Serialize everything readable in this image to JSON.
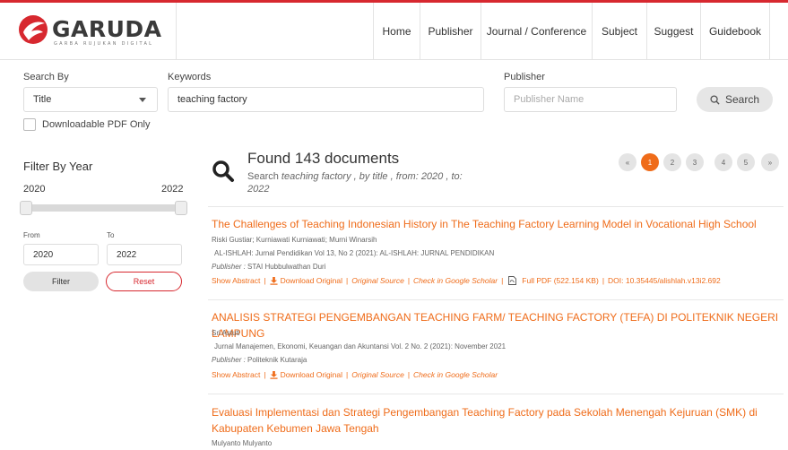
{
  "brand": {
    "name": "GARUDA",
    "tagline": "GARBA RUJUKAN DIGITAL",
    "accent": "#d7282f",
    "orange": "#ef6c1a"
  },
  "nav": [
    "Home",
    "Publisher",
    "Journal / Conference",
    "Subject",
    "Suggest",
    "Guidebook"
  ],
  "search": {
    "search_by_label": "Search By",
    "search_by_value": "Title",
    "keywords_label": "Keywords",
    "keywords_value": "teaching factory",
    "publisher_label": "Publisher",
    "publisher_placeholder": "Publisher Name",
    "search_button": "Search",
    "pdf_only_label": "Downloadable PDF Only"
  },
  "filter": {
    "title": "Filter By Year",
    "min_year": "2020",
    "max_year": "2022",
    "from_label": "From",
    "to_label": "To",
    "from_value": "2020",
    "to_value": "2022",
    "filter_button": "Filter",
    "reset_button": "Reset"
  },
  "results_header": {
    "found": "Found 143 documents",
    "desc_prefix": "Search ",
    "desc_query": "teaching factory",
    "desc_mid": " , by title , from: 2020 , to:",
    "desc_end": "2022"
  },
  "pagination": [
    "«",
    "1",
    "2",
    "3",
    "4",
    "5",
    "»"
  ],
  "results": [
    {
      "title": "The Challenges of Teaching Indonesian History in The Teaching Factory Learning Model in Vocational High School",
      "authors": "Riski Gustiar; Kurniawati Kurniawati; Murni Winarsih",
      "journal": "AL-ISHLAH: Jurnal Pendidikan Vol 13, No 2 (2021): AL-ISHLAH: JURNAL PENDIDIKAN",
      "publisher_label": "Publisher :",
      "publisher": "STAI Hubbulwathan Duri",
      "show_abstract": "Show Abstract",
      "download": "Download Original",
      "source": "Original Source",
      "scholar": "Check in Google Scholar",
      "pdf": "Full PDF (522.154 KB)",
      "doi": "DOI: 10.35445/alishlah.v13i2.692"
    },
    {
      "title": "ANALISIS STRATEGI PENGEMBANGAN TEACHING FARM/ TEACHING FACTORY (TEFA) DI POLITEKNIK NEGERI LAMPUNG",
      "authors": "Sri Astuti",
      "journal": "Jurnal Manajemen, Ekonomi, Keuangan dan Akuntansi Vol. 2 No. 2 (2021): November 2021",
      "publisher_label": "Publisher :",
      "publisher": "Politeknik Kutaraja",
      "show_abstract": "Show Abstract",
      "download": "Download Original",
      "source": "Original Source",
      "scholar": "Check in Google Scholar"
    },
    {
      "title_line1": "Evaluasi Implementasi dan Strategi Pengembangan Teaching Factory pada Sekolah Menengah Kejuruan (SMK) di",
      "title_line2": "Kabupaten Kebumen Jawa Tengah",
      "authors": "Mulyanto Mulyanto"
    }
  ]
}
